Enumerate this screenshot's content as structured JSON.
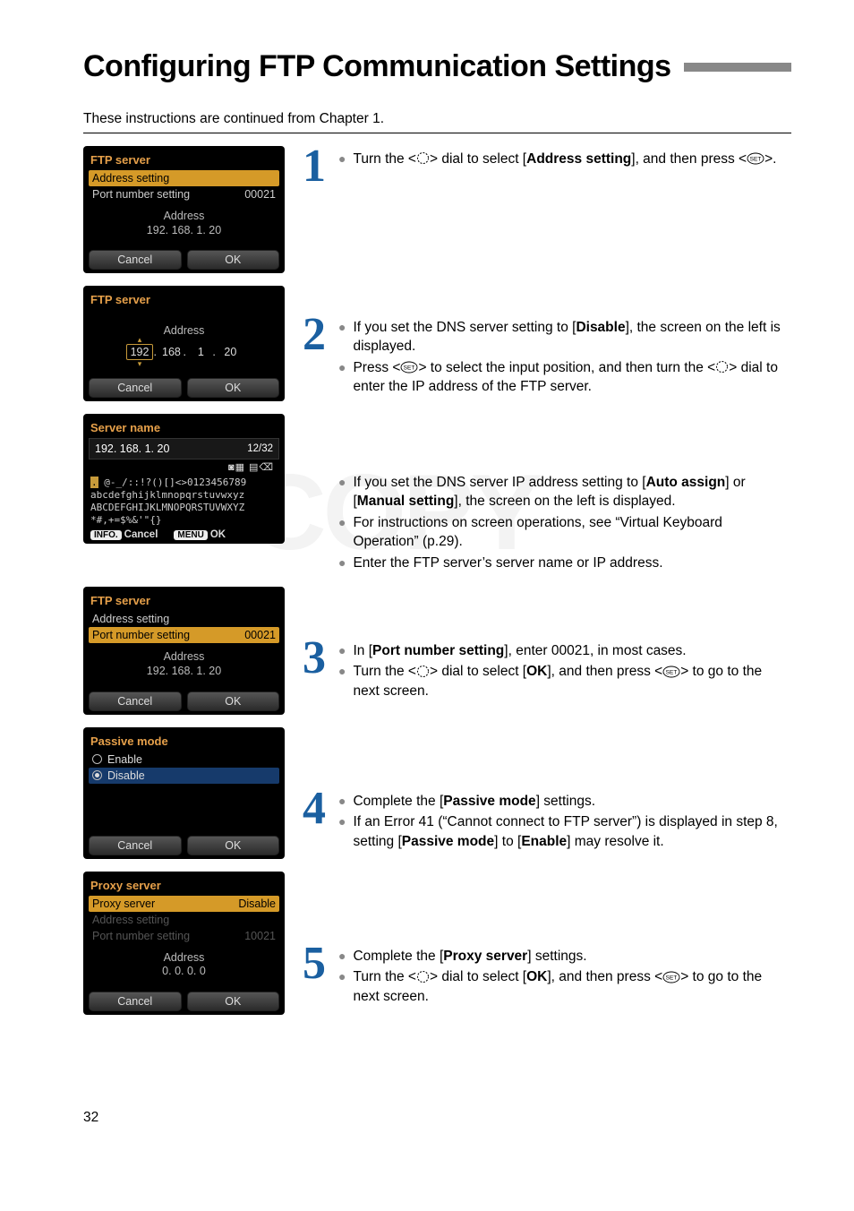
{
  "page": {
    "title": "Configuring FTP Communication Settings",
    "intro": "These instructions are continued from Chapter 1.",
    "page_number": "32"
  },
  "screens": {
    "s1": {
      "header": "FTP server",
      "row1_label": "Address setting",
      "row2_label": "Port number setting",
      "row2_value": "00021",
      "mid_label": "Address",
      "mid_value": "192. 168. 1. 20",
      "cancel": "Cancel",
      "ok": "OK"
    },
    "s2": {
      "header": "FTP server",
      "mid_label": "Address",
      "oct1": "192",
      "oct2": "168",
      "oct3": "1",
      "oct4": "20",
      "cancel": "Cancel",
      "ok": "OK"
    },
    "s3": {
      "header": "Server name",
      "entry_value": "192. 168. 1. 20",
      "counter": "12/32",
      "charset_line1_a": ".",
      "charset_line1_b": " @-_/::!?()[]<>0123456789",
      "charset_line2": "abcdefghijklmnopqrstuvwxyz",
      "charset_line3": "ABCDEFGHIJKLMNOPQRSTUVWXYZ",
      "charset_line4": "*#,+=$%&'\"{} ",
      "info_label": "INFO.",
      "info_text": "Cancel",
      "menu_label": "MENU",
      "menu_text": "OK"
    },
    "s4": {
      "header": "FTP server",
      "row1_label": "Address setting",
      "row2_label": "Port number setting",
      "row2_value": "00021",
      "mid_label": "Address",
      "mid_value": "192. 168. 1. 20",
      "cancel": "Cancel",
      "ok": "OK"
    },
    "s5": {
      "header": "Passive mode",
      "opt1": "Enable",
      "opt2": "Disable",
      "cancel": "Cancel",
      "ok": "OK"
    },
    "s6": {
      "header": "Proxy server",
      "row1_label": "Proxy server",
      "row1_value": "Disable",
      "row2_label": "Address setting",
      "row3_label": "Port number setting",
      "row3_value": "10021",
      "mid_label": "Address",
      "mid_value": "0. 0. 0. 0",
      "cancel": "Cancel",
      "ok": "OK"
    }
  },
  "steps": {
    "n1": "1",
    "n2": "2",
    "n3": "3",
    "n4": "4",
    "n5": "5",
    "s1_b1a": "Turn the <",
    "s1_b1b": "> dial to select [",
    "s1_b1c": "Address setting",
    "s1_b1d": "], and then press <",
    "s1_b1e": ">.",
    "s2_b1a": "If you set the DNS server setting to [",
    "s2_b1b": "Disable",
    "s2_b1c": "], the screen on the left is displayed.",
    "s2_b2a": "Press <",
    "s2_b2b": "> to select the input position, and then turn the <",
    "s2_b2c": "> dial to enter the IP address of the FTP server.",
    "sn_b1a": "If you set the DNS server IP address setting to [",
    "sn_b1b": "Auto assign",
    "sn_b1c": "] or [",
    "sn_b1d": "Manual setting",
    "sn_b1e": "], the screen on the left is displayed.",
    "sn_b2": "For instructions on screen operations, see “Virtual Keyboard Operation” (p.29).",
    "sn_b3": "Enter the FTP server’s server name or IP address.",
    "s3_b1a": "In [",
    "s3_b1b": "Port number setting",
    "s3_b1c": "], enter 00021, in most cases.",
    "s3_b2a": "Turn the <",
    "s3_b2b": "> dial to select [",
    "s3_b2c": "OK",
    "s3_b2d": "], and then press <",
    "s3_b2e": "> to go to the next screen.",
    "s4_b1a": "Complete the [",
    "s4_b1b": "Passive mode",
    "s4_b1c": "] settings.",
    "s4_b2a": "If an Error 41 (“Cannot connect to FTP server”) is displayed in step 8, setting [",
    "s4_b2b": "Passive mode",
    "s4_b2c": "] to [",
    "s4_b2d": "Enable",
    "s4_b2e": "] may resolve it.",
    "s5_b1a": "Complete the [",
    "s5_b1b": "Proxy server",
    "s5_b1c": "] settings.",
    "s5_b2a": "Turn the <",
    "s5_b2b": "> dial to select [",
    "s5_b2c": "OK",
    "s5_b2d": "], and then press <",
    "s5_b2e": "> to go to the next screen."
  }
}
